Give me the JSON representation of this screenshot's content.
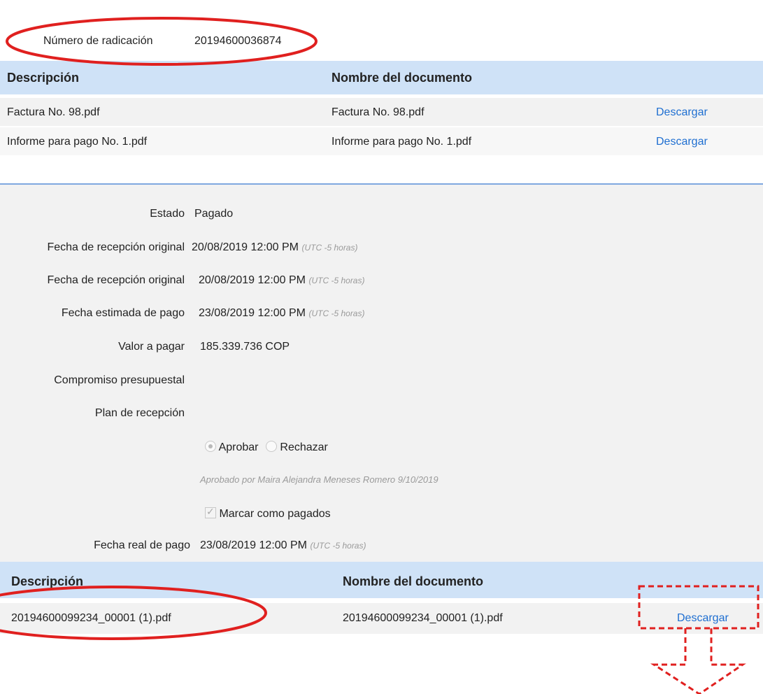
{
  "radicado": {
    "label": "Número de radicación",
    "value": "20194600036874"
  },
  "documents_table": {
    "headers": [
      "Descripción",
      "Nombre del documento"
    ],
    "rows": [
      {
        "description": "Factura No. 98.pdf",
        "name": "Factura No. 98.pdf",
        "action": "Descargar"
      },
      {
        "description": "Informe para pago No. 1.pdf",
        "name": "Informe para pago No. 1.pdf",
        "action": "Descargar"
      }
    ]
  },
  "details": {
    "estado": {
      "label": "Estado",
      "value": "Pagado"
    },
    "recepcion_1": {
      "label": "Fecha de recepción original",
      "value": "20/08/2019 12:00 PM",
      "tz": "(UTC -5 horas)"
    },
    "recepcion_2": {
      "label": "Fecha de recepción original",
      "value": "20/08/2019 12:00 PM",
      "tz": "(UTC -5 horas)"
    },
    "estimada": {
      "label": "Fecha estimada de pago",
      "value": "23/08/2019 12:00 PM",
      "tz": "(UTC -5 horas)"
    },
    "valor": {
      "label": "Valor a pagar",
      "value": "185.339.736 COP"
    },
    "compromiso": {
      "label": "Compromiso presupuestal"
    },
    "plan": {
      "label": "Plan de recepción"
    },
    "approval": {
      "approve_label": "Aprobar",
      "reject_label": "Rechazar",
      "selected": "Aprobar",
      "note": "Aprobado por Maira Alejandra Meneses Romero 9/10/2019"
    },
    "mark_paid": {
      "label": "Marcar como pagados",
      "checked": true
    },
    "real": {
      "label": "Fecha real de pago",
      "value": "23/08/2019 12:00 PM",
      "tz": "(UTC -5 horas)"
    }
  },
  "payment_docs_table": {
    "headers": [
      "Descripción",
      "Nombre del documento"
    ],
    "rows": [
      {
        "description": "20194600099234_00001 (1).pdf",
        "name": "20194600099234_00001 (1).pdf",
        "action": "Descargar"
      }
    ]
  },
  "colors": {
    "annotation_red": "#e0201f",
    "link_blue": "#1f6fd1",
    "header_bg": "#cfe2f7"
  }
}
